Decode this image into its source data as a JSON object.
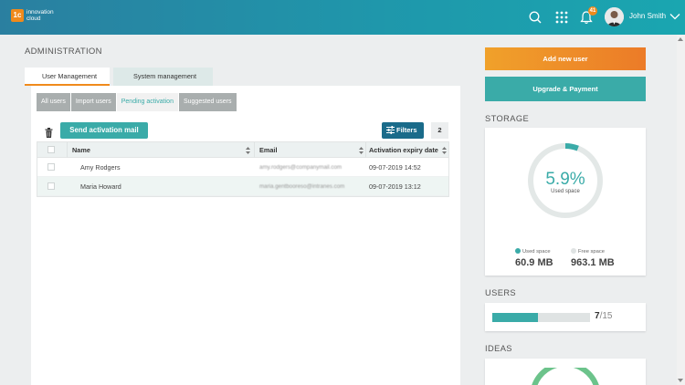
{
  "header": {
    "logo_mark": "1c",
    "logo_text": "innovation cloud",
    "icons": [
      "search-icon",
      "apps-grid-icon",
      "bell-icon",
      "chevron-down-icon"
    ],
    "notification_count": "41",
    "user_name": "John Smith"
  },
  "page": {
    "title": "ADMINISTRATION",
    "tabs": [
      {
        "label": "User Management",
        "active": true
      },
      {
        "label": "System management",
        "active": false
      }
    ],
    "subtabs": [
      {
        "label": "All users",
        "active": false
      },
      {
        "label": "Import users",
        "active": false
      },
      {
        "label": "Pending activation",
        "active": true
      },
      {
        "label": "Suggested users",
        "active": false
      }
    ]
  },
  "toolbar": {
    "send_label": "Send activation mail",
    "filters_label": "Filters",
    "filter_count": "2"
  },
  "table": {
    "columns": [
      "Name",
      "Email",
      "Activation expiry date"
    ],
    "rows": [
      {
        "name": "Amy Rodgers",
        "email": "amy.rodgers@companymail.com",
        "date": "09-07-2019 14:52"
      },
      {
        "name": "Maria Howard",
        "email": "maria.gentbooreso@intranes.com",
        "date": "09-07-2019 13:12"
      }
    ]
  },
  "sidebar": {
    "add_user_label": "Add new user",
    "upgrade_label": "Upgrade & Payment",
    "storage": {
      "title": "STORAGE",
      "used_percent": 5.9,
      "percent_label": "5.9%",
      "used_caption": "Used space",
      "used_label": "Used space",
      "used_value": "60.9 MB",
      "free_label": "Free space",
      "free_value": "963.1 MB"
    },
    "users": {
      "title": "USERS",
      "current": "7",
      "total": "/15",
      "fraction": 0.4667
    },
    "ideas": {
      "title": "IDEAS"
    }
  },
  "colors": {
    "teal": "#3aaba8",
    "orange": "#f08a1c",
    "header_blue": "#2a7fa0",
    "filters_blue": "#1a6b8a"
  }
}
